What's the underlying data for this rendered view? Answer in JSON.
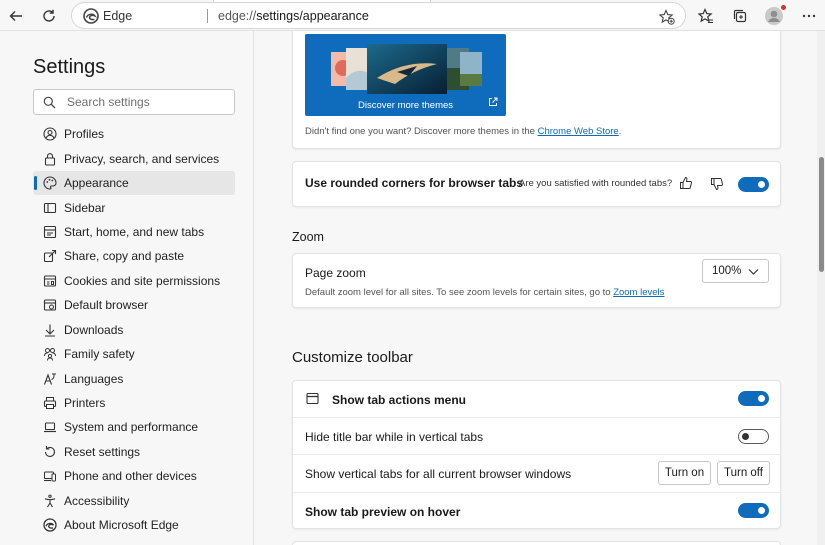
{
  "browser": {
    "brand": "Edge",
    "url_prefix": "edge://",
    "url_path": "settings/appearance",
    "profile_badge_color": "#d13438"
  },
  "sidebar": {
    "title": "Settings",
    "search_placeholder": "Search settings",
    "items": [
      {
        "label": "Profiles",
        "icon": "profile-icon",
        "active": false
      },
      {
        "label": "Privacy, search, and services",
        "icon": "lock-icon",
        "active": false
      },
      {
        "label": "Appearance",
        "icon": "palette-icon",
        "active": true
      },
      {
        "label": "Sidebar",
        "icon": "sidebar-icon",
        "active": false
      },
      {
        "label": "Start, home, and new tabs",
        "icon": "home-tabs-icon",
        "active": false
      },
      {
        "label": "Share, copy and paste",
        "icon": "share-icon",
        "active": false
      },
      {
        "label": "Cookies and site permissions",
        "icon": "site-permissions-icon",
        "active": false
      },
      {
        "label": "Default browser",
        "icon": "browser-icon",
        "active": false
      },
      {
        "label": "Downloads",
        "icon": "download-icon",
        "active": false
      },
      {
        "label": "Family safety",
        "icon": "family-icon",
        "active": false
      },
      {
        "label": "Languages",
        "icon": "languages-icon",
        "active": false
      },
      {
        "label": "Printers",
        "icon": "printer-icon",
        "active": false
      },
      {
        "label": "System and performance",
        "icon": "laptop-icon",
        "active": false
      },
      {
        "label": "Reset settings",
        "icon": "reset-icon",
        "active": false
      },
      {
        "label": "Phone and other devices",
        "icon": "phone-icon",
        "active": false
      },
      {
        "label": "Accessibility",
        "icon": "accessibility-icon",
        "active": false
      },
      {
        "label": "About Microsoft Edge",
        "icon": "edge-logo-icon",
        "active": false
      }
    ]
  },
  "themes": {
    "discover_label": "Discover more themes",
    "note_prefix": "Didn't find one you want? Discover more themes in the ",
    "note_link": "Chrome Web Store",
    "note_suffix": "."
  },
  "rounded_corners": {
    "label": "Use rounded corners for browser tabs",
    "feedback_question": "Are you satisfied with rounded tabs?",
    "enabled": true
  },
  "zoom": {
    "section_title": "Zoom",
    "page_zoom_label": "Page zoom",
    "page_zoom_value": "100%",
    "note_prefix": "Default zoom level for all sites. To see zoom levels for certain sites, go to ",
    "note_link": "Zoom levels"
  },
  "toolbar_section": {
    "title": "Customize toolbar",
    "tab_actions": {
      "label": "Show tab actions menu",
      "enabled": true
    },
    "hide_title_bar": {
      "label": "Hide title bar while in vertical tabs",
      "enabled": false
    },
    "vertical_tabs": {
      "label": "Show vertical tabs for all current browser windows",
      "turn_on": "Turn on",
      "turn_off": "Turn off"
    },
    "tab_preview": {
      "label": "Show tab preview on hover",
      "enabled": true
    }
  },
  "colors": {
    "accent": "#0f6cbd",
    "page_background": "#f7f7f7",
    "card_background": "#ffffff"
  }
}
